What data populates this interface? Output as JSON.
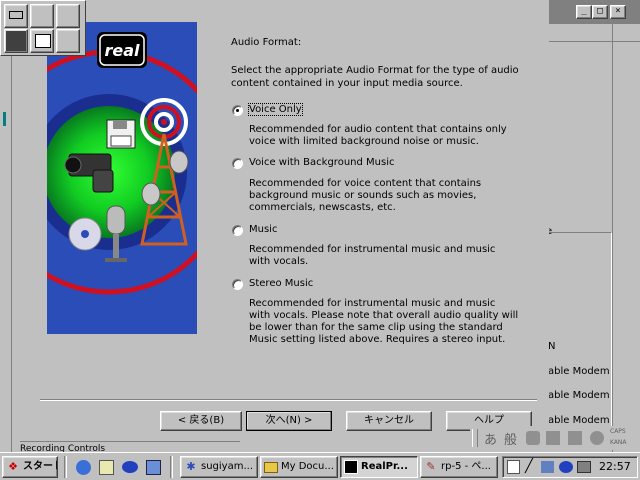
{
  "wizard": {
    "heading": "Audio Format:",
    "description": "Select the appropriate Audio Format for the type of audio content contained in your input media source.",
    "options": [
      {
        "label": "Voice Only",
        "selected": true,
        "desc": "Recommended for audio content that contains only voice with limited background noise or music."
      },
      {
        "label": "Voice with Background Music",
        "selected": false,
        "desc": "Recommended for voice content that contains background music or sounds such as movies, commercials, newscasts, etc."
      },
      {
        "label": "Music",
        "selected": false,
        "desc": "Recommended for instrumental music and music with vocals."
      },
      {
        "label": "Stereo Music",
        "selected": false,
        "desc": "Recommended for instrumental music and music with vocals.  Please note that overall audio quality will be lower than for the same clip using the standard Music setting listed above.  Requires a stereo input."
      }
    ],
    "buttons": {
      "back": "< 戻る(B)",
      "next": "次へ(N) >",
      "cancel": "キャンセル",
      "help": "ヘルプ"
    },
    "logo": "real"
  },
  "background_window": {
    "controls": [
      "_",
      "□",
      "×"
    ],
    "panel_text": [
      "e",
      "N",
      "able Modem",
      "able Modem",
      "able Modem"
    ]
  },
  "recording_controls_label": "Recording Controls",
  "ime_bar": {
    "items": [
      "あ",
      "般"
    ],
    "caps": "CAPS",
    "kana": "KANA"
  },
  "taskbar": {
    "start": "スタート",
    "tasks": [
      {
        "label": "sugiyam...",
        "icon": "globe-icon"
      },
      {
        "label": "My Docu...",
        "icon": "folder-icon"
      },
      {
        "label": "RealPr...",
        "icon": "realproducer-icon",
        "active": true
      },
      {
        "label": "rp-5 - ペ...",
        "icon": "paint-icon"
      }
    ],
    "clock": "22:57"
  },
  "colors": {
    "hero_bg": "#2a4db8",
    "titlebar_inactive": "#808080",
    "face": "#c0c0c0"
  }
}
